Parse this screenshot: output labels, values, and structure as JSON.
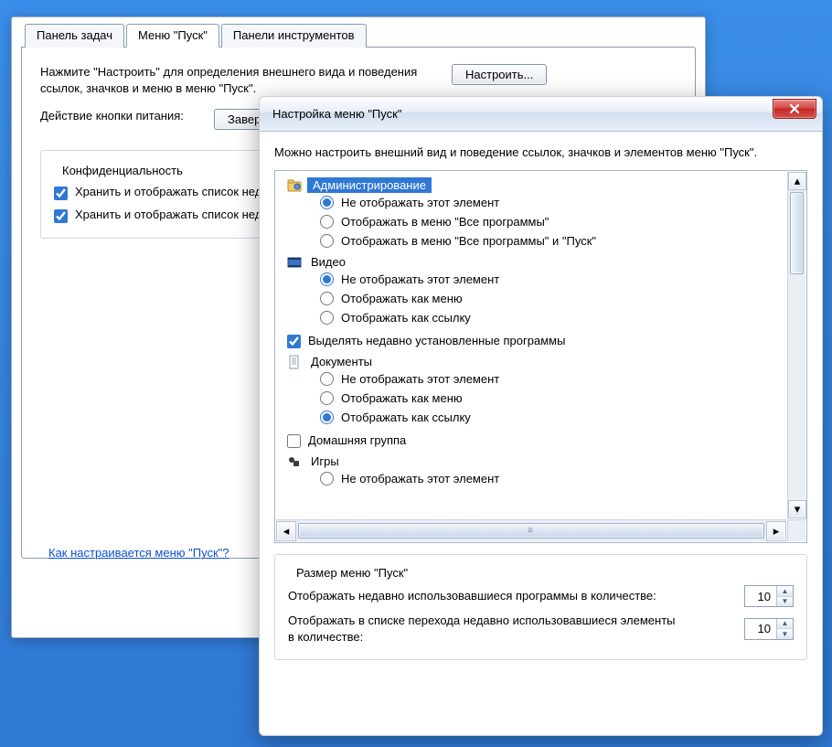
{
  "tabs": {
    "t0": "Панель задач",
    "t1": "Меню \"Пуск\"",
    "t2": "Панели инструментов"
  },
  "back": {
    "intro": "Нажмите \"Настроить\" для определения внешнего вида и поведения ссылок, значков и меню в меню \"Пуск\".",
    "configure": "Настроить...",
    "power_label": "Действие кнопки питания:",
    "power_value": "Заверш",
    "priv_title": "Конфиденциальность",
    "priv_cb1": "Хранить и отображать список недавно открывавшихся программ в меню \"Пуск\"",
    "priv_cb2": "Хранить и отображать список недавно открывавшихся элементов в меню \"Пуск\" и на панели задач",
    "help_link": "Как настраивается меню \"Пуск\"?"
  },
  "dlg": {
    "title": "Настройка меню \"Пуск\"",
    "desc": "Можно настроить внешний вид и поведение ссылок, значков и элементов меню \"Пуск\"."
  },
  "tree": {
    "g1": {
      "title": "Администрирование",
      "o1": "Не отображать этот элемент",
      "o2": "Отображать в меню \"Все программы\"",
      "o3": "Отображать в меню \"Все программы\" и \"Пуск\""
    },
    "g2": {
      "title": "Видео",
      "o1": "Не отображать этот элемент",
      "o2": "Отображать как меню",
      "o3": "Отображать как ссылку"
    },
    "cbHighlight": "Выделять недавно установленные программы",
    "g3": {
      "title": "Документы",
      "o1": "Не отображать этот элемент",
      "o2": "Отображать как меню",
      "o3": "Отображать как ссылку"
    },
    "cbHome": "Домашняя группа",
    "g4": {
      "title": "Игры",
      "o1": "Не отображать этот элемент"
    }
  },
  "sz": {
    "title": "Размер меню \"Пуск\"",
    "r1": "Отображать недавно использовавшиеся программы в количестве:",
    "v1": "10",
    "r2": "Отображать в списке перехода недавно использовавшиеся элементы в количестве:",
    "v2": "10"
  }
}
